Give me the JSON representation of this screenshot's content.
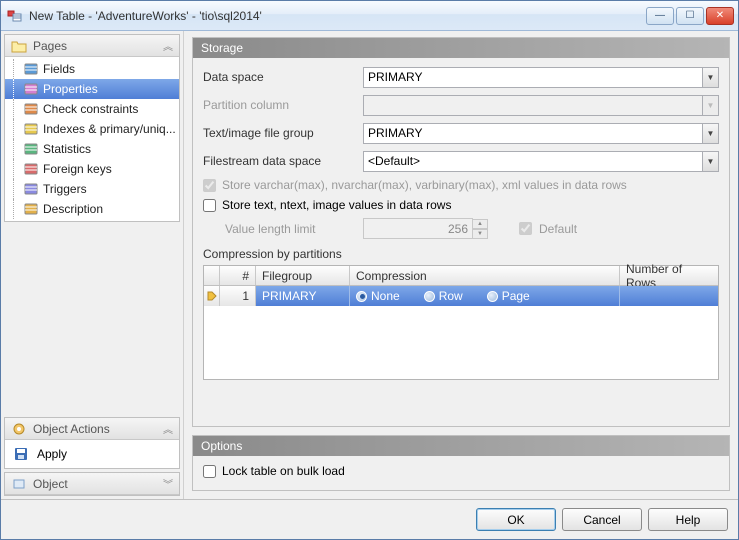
{
  "window": {
    "title": "New Table - 'AdventureWorks' - 'tio\\sql2014'",
    "min_glyph": "—",
    "max_glyph": "☐",
    "close_glyph": "✕"
  },
  "sidebar": {
    "pages_label": "Pages",
    "items": [
      {
        "label": "Fields"
      },
      {
        "label": "Properties"
      },
      {
        "label": "Check constraints"
      },
      {
        "label": "Indexes & primary/uniq..."
      },
      {
        "label": "Statistics"
      },
      {
        "label": "Foreign keys"
      },
      {
        "label": "Triggers"
      },
      {
        "label": "Description"
      }
    ],
    "selected_index": 1,
    "object_actions_label": "Object Actions",
    "apply_label": "Apply",
    "object_label": "Object"
  },
  "storage": {
    "header": "Storage",
    "data_space_label": "Data space",
    "data_space_value": "PRIMARY",
    "partition_column_label": "Partition column",
    "partition_column_value": "",
    "text_image_label": "Text/image file group",
    "text_image_value": "PRIMARY",
    "filestream_label": "Filestream data space",
    "filestream_value": "<Default>",
    "store_varchar_label": "Store varchar(max), nvarchar(max), varbinary(max), xml values in data rows",
    "store_varchar_checked": true,
    "store_text_label": "Store text, ntext, image values in data rows",
    "store_text_checked": false,
    "value_length_label": "Value length limit",
    "value_length_value": "256",
    "value_length_default_label": "Default",
    "value_length_default_checked": true,
    "compression_label": "Compression by partitions",
    "table": {
      "col_hash": "#",
      "col_fg": "Filegroup",
      "col_comp": "Compression",
      "col_rows": "Number of Rows",
      "rows": [
        {
          "num": "1",
          "filegroup": "PRIMARY",
          "compression": "None",
          "opts": {
            "none": "None",
            "row": "Row",
            "page": "Page"
          },
          "number_of_rows": ""
        }
      ]
    }
  },
  "options": {
    "header": "Options",
    "lock_on_bulk_label": "Lock table on bulk load",
    "lock_on_bulk_checked": false
  },
  "footer": {
    "ok": "OK",
    "cancel": "Cancel",
    "help": "Help"
  }
}
